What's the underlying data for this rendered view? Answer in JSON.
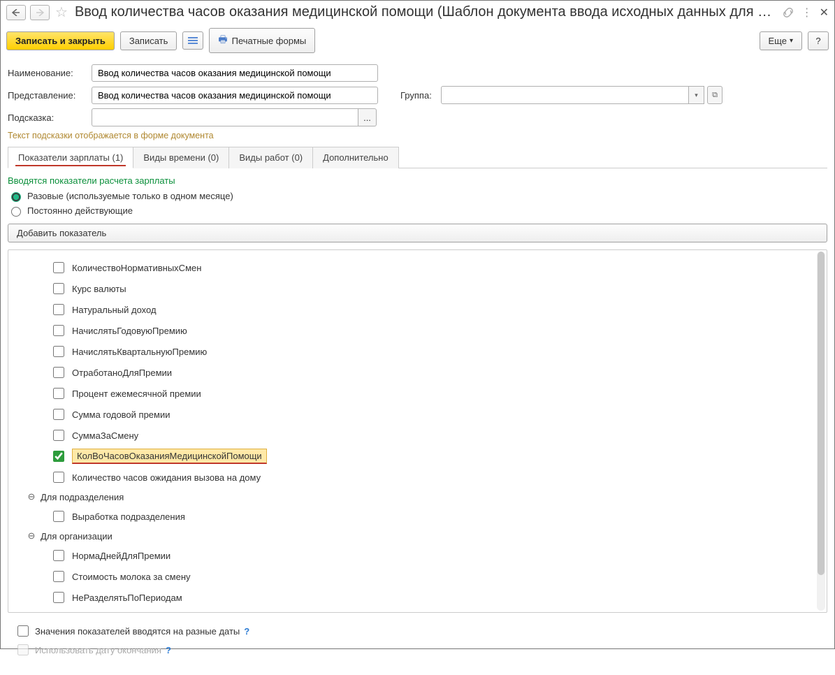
{
  "title": "Ввод количества часов оказания медицинской помощи (Шаблон документа ввода исходных данных для рас...",
  "toolbar": {
    "save_close": "Записать и закрыть",
    "save": "Записать",
    "print_forms": "Печатные формы",
    "more": "Еще",
    "help": "?"
  },
  "fields": {
    "name_label": "Наименование:",
    "name_value": "Ввод количества часов оказания медицинской помощи",
    "repr_label": "Представление:",
    "repr_value": "Ввод количества часов оказания медицинской помощи",
    "group_label": "Группа:",
    "group_value": "",
    "hint_label": "Подсказка:",
    "hint_value": "",
    "hint_btn": "...",
    "hint_help_text": "Текст подсказки отображается в форме документа"
  },
  "tabs": {
    "t1": "Показатели зарплаты (1)",
    "t2": "Виды времени (0)",
    "t3": "Виды работ (0)",
    "t4": "Дополнительно"
  },
  "tab1": {
    "caption": "Вводятся показатели расчета зарплаты",
    "radio1": "Разовые (используемые только в одном месяце)",
    "radio2": "Постоянно действующие",
    "add_button": "Добавить показатель"
  },
  "items": {
    "i1": "КоличествоНормативныхСмен",
    "i2": "Курс валюты",
    "i3": "Натуральный доход",
    "i4": "НачислятьГодовуюПремию",
    "i5": "НачислятьКвартальнуюПремию",
    "i6": "ОтработаноДляПремии",
    "i7": "Процент ежемесячной премии",
    "i8": "Сумма годовой премии",
    "i9": "СуммаЗаСмену",
    "i10": "КолВоЧасовОказанияМедицинскойПомощи",
    "i11": "Количество часов ожидания вызова на дому",
    "g2": "Для подразделения",
    "i12": "Выработка подразделения",
    "g3": "Для организации",
    "i13": "НормаДнейДляПремии",
    "i14": "Стоимость молока за смену",
    "i15": "НеРазделятьПоПериодам"
  },
  "footer": {
    "f1": "Значения показателей вводятся на разные даты",
    "f2": "Использовать дату окончания"
  }
}
